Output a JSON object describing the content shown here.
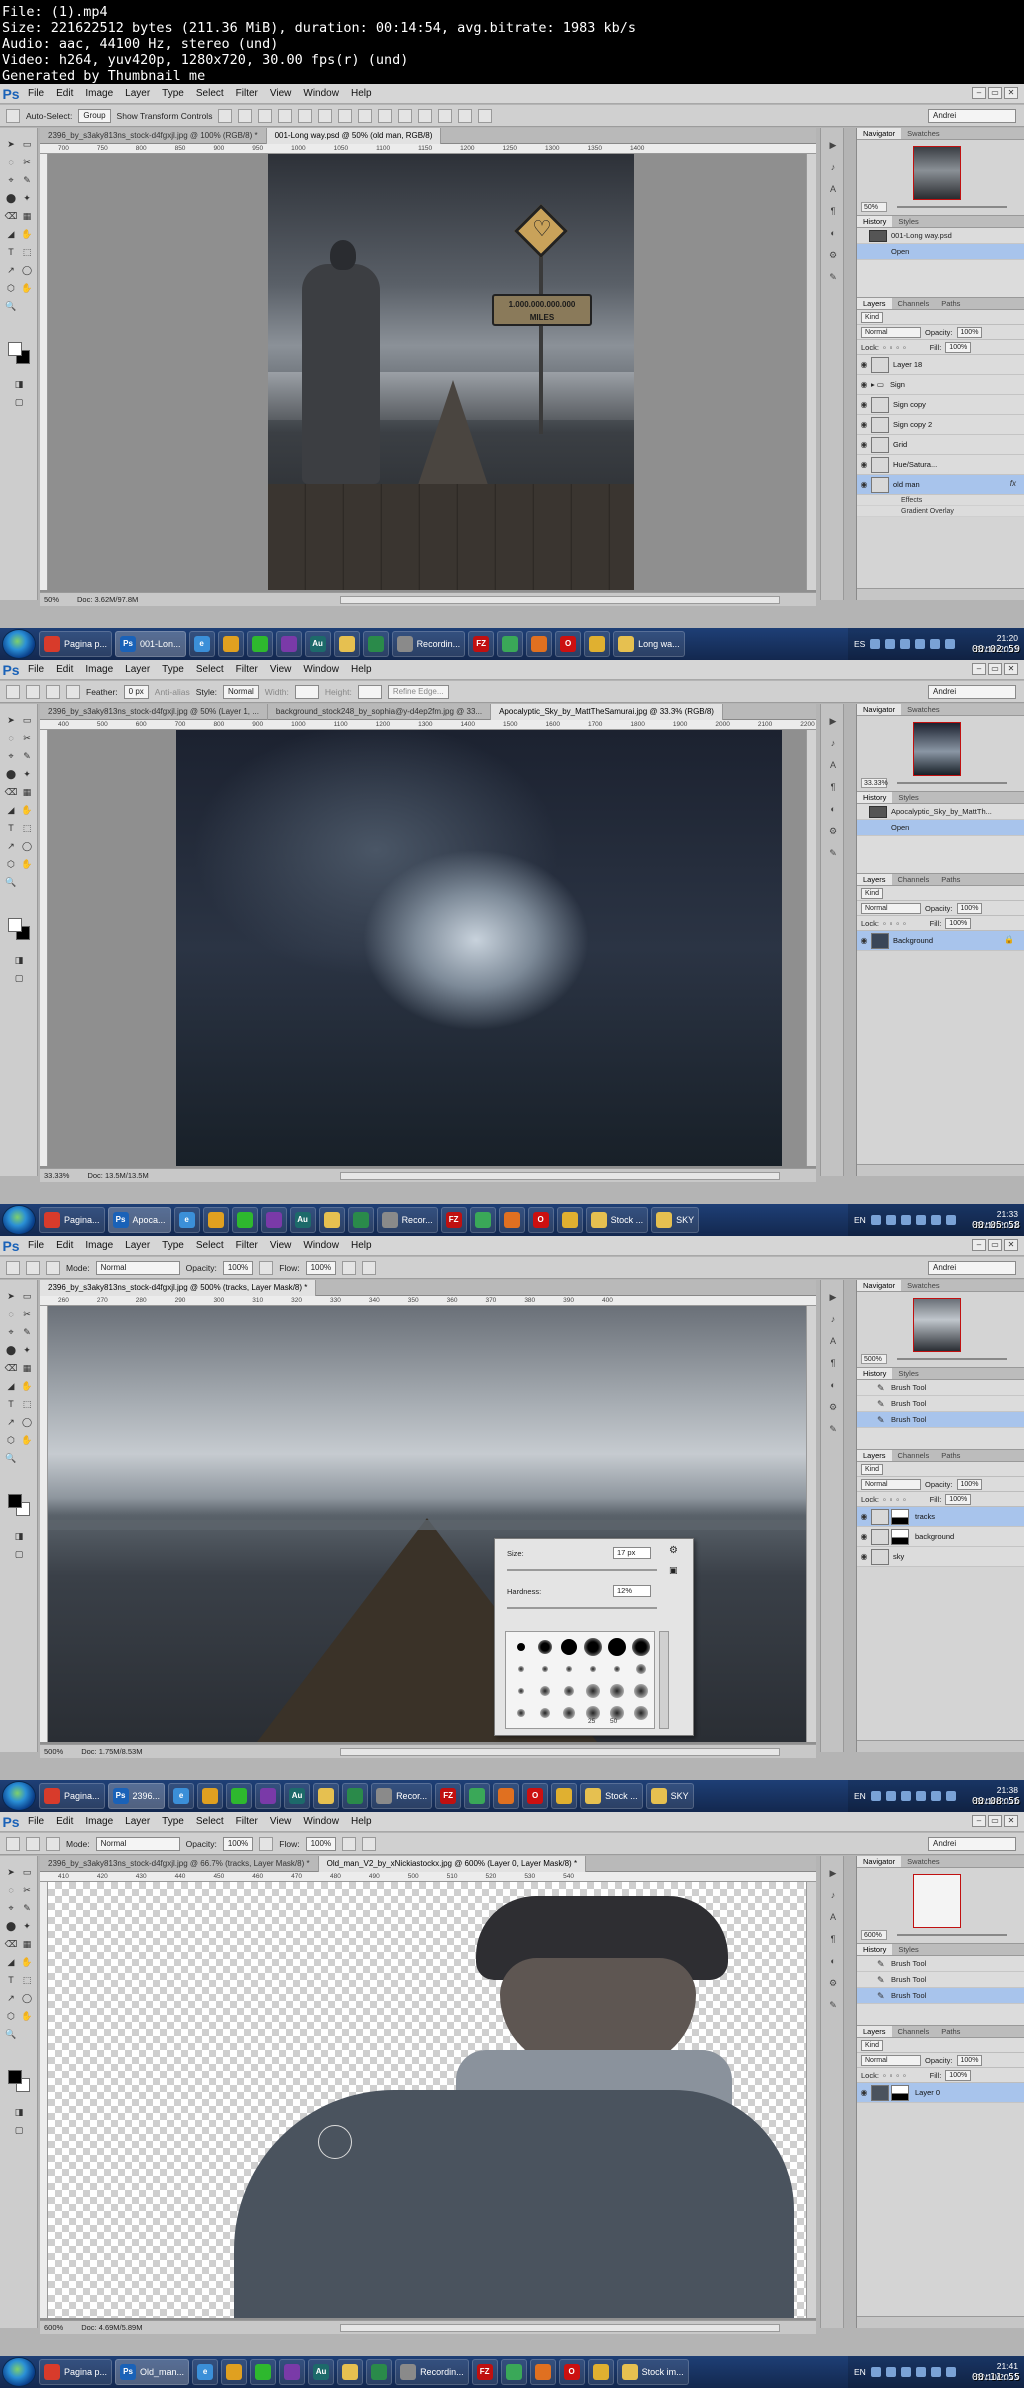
{
  "header": {
    "lines": [
      "File: (1).mp4",
      "Size: 221622512 bytes (211.36 MiB), duration: 00:14:54, avg.bitrate: 1983 kb/s",
      "Audio: aac, 44100 Hz, stereo (und)",
      "Video: h264, yuv420p, 1280x720, 30.00 fps(r) (und)",
      "Generated by Thumbnail me"
    ]
  },
  "app": {
    "logo": "Ps",
    "menu": [
      "File",
      "Edit",
      "Image",
      "Layer",
      "Type",
      "Select",
      "Filter",
      "View",
      "Window",
      "Help"
    ],
    "workspace": "Andrei"
  },
  "frames": [
    {
      "options": {
        "auto_select_label": "Auto-Select:",
        "auto_select_value": "Group",
        "transform_label": "Show Transform Controls"
      },
      "tabs": [
        "2396_by_s3aky813ns_stock-d4fgxjl.jpg @ 100% (RGB/8) *",
        "001-Long way.psd @ 50% (old man, RGB/8)"
      ],
      "ruler": [
        "700",
        "750",
        "800",
        "850",
        "900",
        "950",
        "1000",
        "1050",
        "1100",
        "1150",
        "1200",
        "1250",
        "1300",
        "1350",
        "1400"
      ],
      "sign": {
        "mileage": "1.000.000.000.000",
        "unit": "MILES"
      },
      "status": {
        "zoom": "50%",
        "doc": "Doc: 3.62M/97.8M"
      },
      "navigator": {
        "zoom": "50%"
      },
      "history": [
        {
          "label": "001-Long way.psd",
          "snapshot": true
        },
        {
          "label": "Open",
          "selected": true
        }
      ],
      "layers": {
        "kind": "Kind",
        "blend": "Normal",
        "opacity_label": "Opacity:",
        "opacity": "100%",
        "lock_label": "Lock:",
        "fill_label": "Fill:",
        "fill": "100%",
        "rows": [
          {
            "name": "Layer 18"
          },
          {
            "name": "Sign",
            "folder": true
          },
          {
            "name": "Sign copy"
          },
          {
            "name": "Sign copy 2"
          },
          {
            "name": "Grid"
          },
          {
            "name": "Hue/Satura..."
          },
          {
            "name": "old man",
            "selected": true,
            "fx": "fx"
          }
        ],
        "effects": [
          "Effects",
          "Gradient Overlay"
        ]
      },
      "taskbar": {
        "apps": [
          "Pagina p...",
          "001-Lon...",
          "",
          "",
          "",
          "",
          "Au",
          "",
          "",
          "Recordin...",
          "FZ",
          "",
          "",
          "",
          "",
          "Long wa..."
        ],
        "lang": "ES",
        "clock_time": "21:20",
        "clock_date": "22/10/2013",
        "stamp": "00:02:59"
      }
    },
    {
      "options": {
        "feather_label": "Feather:",
        "feather_value": "0 px",
        "antialias": "Anti-alias",
        "style_label": "Style:",
        "style_value": "Normal",
        "width_label": "Width:",
        "height_label": "Height:",
        "refine": "Refine Edge..."
      },
      "tabs": [
        "2396_by_s3aky813ns_stock-d4fgxjl.jpg @ 50% (Layer 1, ...",
        "background_stock248_by_sophia@y-d4ep2fm.jpg @ 33...",
        "Apocalyptic_Sky_by_MattTheSamurai.jpg @ 33.3% (RGB/8)"
      ],
      "ruler": [
        "400",
        "500",
        "600",
        "700",
        "800",
        "900",
        "1000",
        "1100",
        "1200",
        "1300",
        "1400",
        "1500",
        "1600",
        "1700",
        "1800",
        "1900",
        "2000",
        "2100",
        "2200"
      ],
      "status": {
        "zoom": "33.33%",
        "doc": "Doc: 13.5M/13.5M"
      },
      "navigator": {
        "zoom": "33.33%"
      },
      "history": [
        {
          "label": "Apocalyptic_Sky_by_MattTh...",
          "snapshot": true
        },
        {
          "label": "Open",
          "selected": true
        }
      ],
      "layers": {
        "kind": "Kind",
        "blend": "Normal",
        "opacity_label": "Opacity:",
        "opacity": "100%",
        "lock_label": "Lock:",
        "fill_label": "Fill:",
        "fill": "100%",
        "rows": [
          {
            "name": "Background",
            "selected": true,
            "locked": true
          }
        ]
      },
      "taskbar": {
        "apps": [
          "Pagina...",
          "Apoca...",
          "",
          "",
          "",
          "",
          "Au",
          "",
          "",
          "Recor...",
          "FZ",
          "",
          "",
          "",
          "",
          "Stock ...",
          "SKY"
        ],
        "lang": "EN",
        "clock_time": "21:33",
        "clock_date": "22/10/2013",
        "stamp": "00:05:58"
      }
    },
    {
      "options": {
        "mode_label": "Mode:",
        "mode_value": "Normal",
        "opacity_label": "Opacity:",
        "opacity_value": "100%",
        "flow_label": "Flow:",
        "flow_value": "100%"
      },
      "tabs": [
        "2396_by_s3aky813ns_stock-d4fgxjl.jpg @ 500% (tracks, Layer Mask/8) *"
      ],
      "ruler": [
        "260",
        "270",
        "280",
        "290",
        "300",
        "310",
        "320",
        "330",
        "340",
        "350",
        "360",
        "370",
        "380",
        "390",
        "400"
      ],
      "status": {
        "zoom": "500%",
        "doc": "Doc: 1.75M/8.53M"
      },
      "navigator": {
        "zoom": "500%"
      },
      "history": [
        {
          "label": "Brush Tool"
        },
        {
          "label": "Brush Tool"
        },
        {
          "label": "Brush Tool",
          "selected": true
        }
      ],
      "layers": {
        "kind": "Kind",
        "blend": "Normal",
        "opacity_label": "Opacity:",
        "opacity": "100%",
        "lock_label": "Lock:",
        "fill_label": "Fill:",
        "fill": "100%",
        "rows": [
          {
            "name": "tracks",
            "selected": true,
            "mask": true
          },
          {
            "name": "background",
            "mask": true
          },
          {
            "name": "sky"
          }
        ]
      },
      "brush_popup": {
        "size_label": "Size:",
        "size_value": "17 px",
        "hardness_label": "Hardness:",
        "hardness_value": "12%",
        "tip_numbers": [
          "25",
          "50"
        ]
      },
      "taskbar": {
        "apps": [
          "Pagina...",
          "2396...",
          "",
          "",
          "",
          "",
          "Au",
          "",
          "",
          "Recor...",
          "FZ",
          "",
          "",
          "",
          "",
          "Stock ...",
          "SKY"
        ],
        "lang": "EN",
        "clock_time": "21:38",
        "clock_date": "22/10/2013",
        "stamp": "00:08:56"
      }
    },
    {
      "options": {
        "mode_label": "Mode:",
        "mode_value": "Normal",
        "opacity_label": "Opacity:",
        "opacity_value": "100%",
        "flow_label": "Flow:",
        "flow_value": "100%"
      },
      "tabs": [
        "2396_by_s3aky813ns_stock-d4fgxjl.jpg @ 66.7% (tracks, Layer Mask/8) *",
        "Old_man_V2_by_xNickiastockx.jpg @ 600% (Layer 0, Layer Mask/8) *"
      ],
      "ruler": [
        "410",
        "420",
        "430",
        "440",
        "450",
        "460",
        "470",
        "480",
        "490",
        "500",
        "510",
        "520",
        "530",
        "540"
      ],
      "status": {
        "zoom": "600%",
        "doc": "Doc: 4.69M/5.89M"
      },
      "navigator": {
        "zoom": "600%"
      },
      "history": [
        {
          "label": "Brush Tool"
        },
        {
          "label": "Brush Tool"
        },
        {
          "label": "Brush Tool",
          "selected": true
        }
      ],
      "layers": {
        "kind": "Kind",
        "blend": "Normal",
        "opacity_label": "Opacity:",
        "opacity": "100%",
        "lock_label": "Lock:",
        "fill_label": "Fill:",
        "fill": "100%",
        "rows": [
          {
            "name": "Layer 0",
            "selected": true,
            "mask": true
          }
        ]
      },
      "taskbar": {
        "apps": [
          "Pagina p...",
          "Old_man...",
          "",
          "",
          "",
          "",
          "Au",
          "",
          "",
          "Recordin...",
          "FZ",
          "",
          "",
          "",
          "",
          "Stock im..."
        ],
        "lang": "EN",
        "clock_time": "21:41",
        "clock_date": "22/10/2013",
        "stamp": "00:11:55"
      }
    }
  ],
  "panel_tabs": {
    "navigator": "Navigator",
    "swatches": "Swatches",
    "history": "History",
    "styles": "Styles",
    "layers": "Layers",
    "channels": "Channels",
    "paths": "Paths"
  },
  "colors": {
    "taskbar": "#1e3f76",
    "selection": "#a8c4ec",
    "ps_blue": "#1a62b8"
  }
}
